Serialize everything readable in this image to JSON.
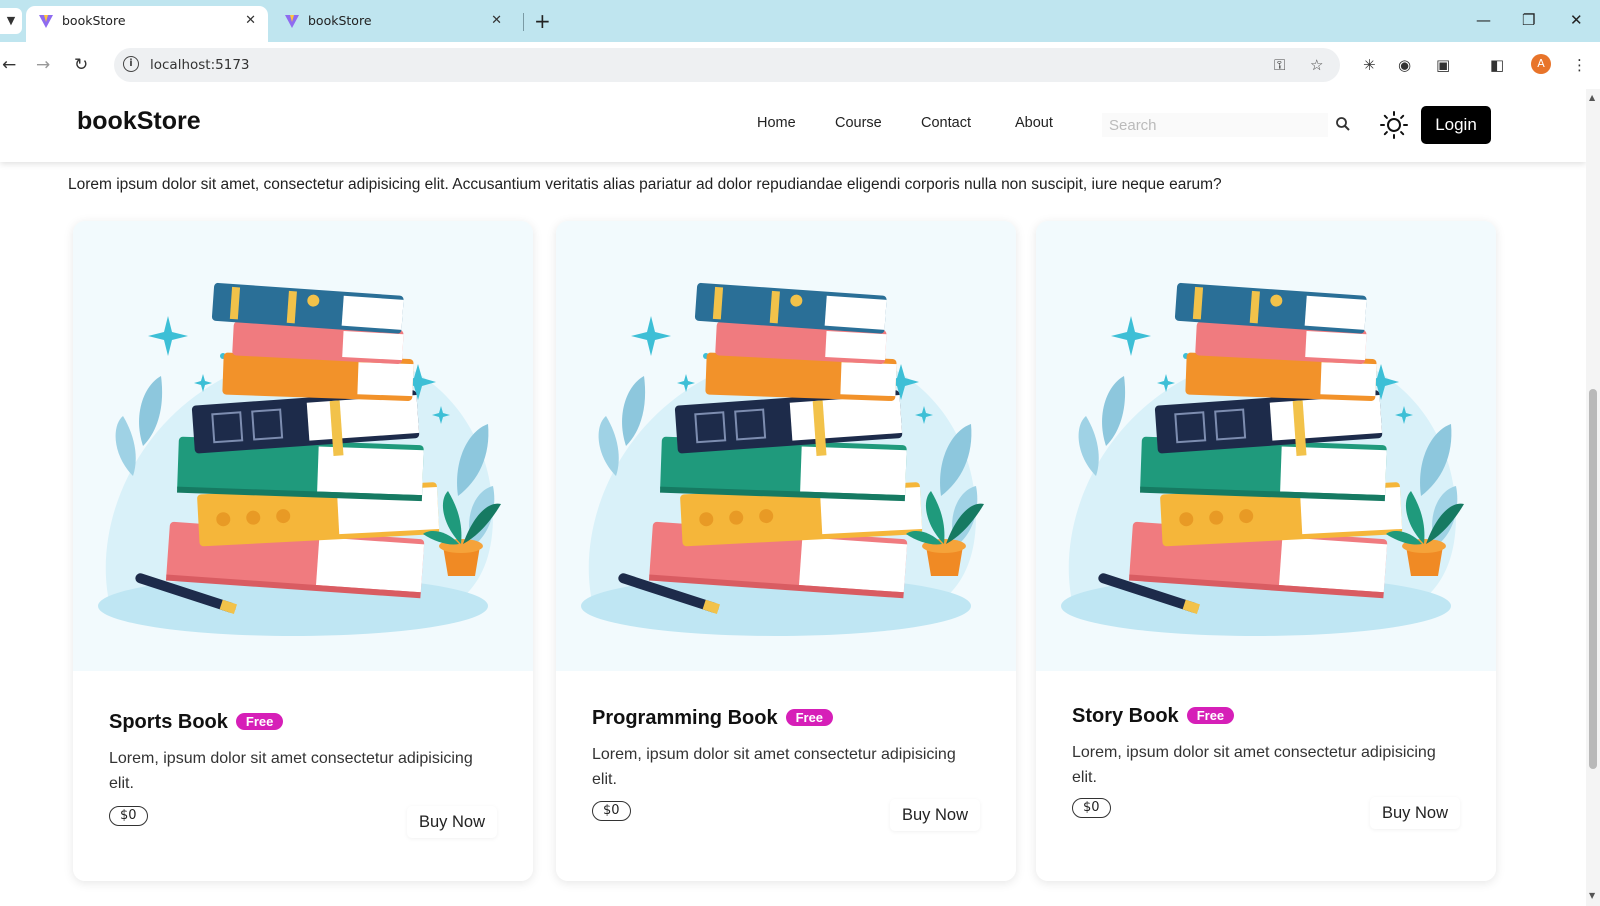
{
  "browser": {
    "tabs": [
      {
        "title": "bookStore",
        "active": true
      },
      {
        "title": "bookStore",
        "active": false
      }
    ],
    "url": "localhost:5173",
    "profile_initial": "A"
  },
  "navbar": {
    "brand": "bookStore",
    "links": [
      "Home",
      "Course",
      "Contact",
      "About"
    ],
    "search_placeholder": "Search",
    "login_label": "Login"
  },
  "intro_text": "Lorem ipsum dolor sit amet, consectetur adipisicing elit. Accusantium veritatis alias pariatur ad dolor repudiandae eligendi corporis nulla non suscipit, iure neque earum?",
  "cards": [
    {
      "title": "Sports Book",
      "badge": "Free",
      "description": "Lorem, ipsum dolor sit amet consectetur adipisicing elit.",
      "price": "$0",
      "button": "Buy Now"
    },
    {
      "title": "Programming Book",
      "badge": "Free",
      "description": "Lorem, ipsum dolor sit amet consectetur adipisicing elit.",
      "price": "$0",
      "button": "Buy Now"
    },
    {
      "title": "Story Book",
      "badge": "Free",
      "description": "Lorem, ipsum dolor sit amet consectetur adipisicing elit.",
      "price": "$0",
      "button": "Buy Now"
    }
  ],
  "colors": {
    "badge": "#d61fb8",
    "login_bg": "#000000",
    "tabbar_bg": "#bfe5ef"
  }
}
